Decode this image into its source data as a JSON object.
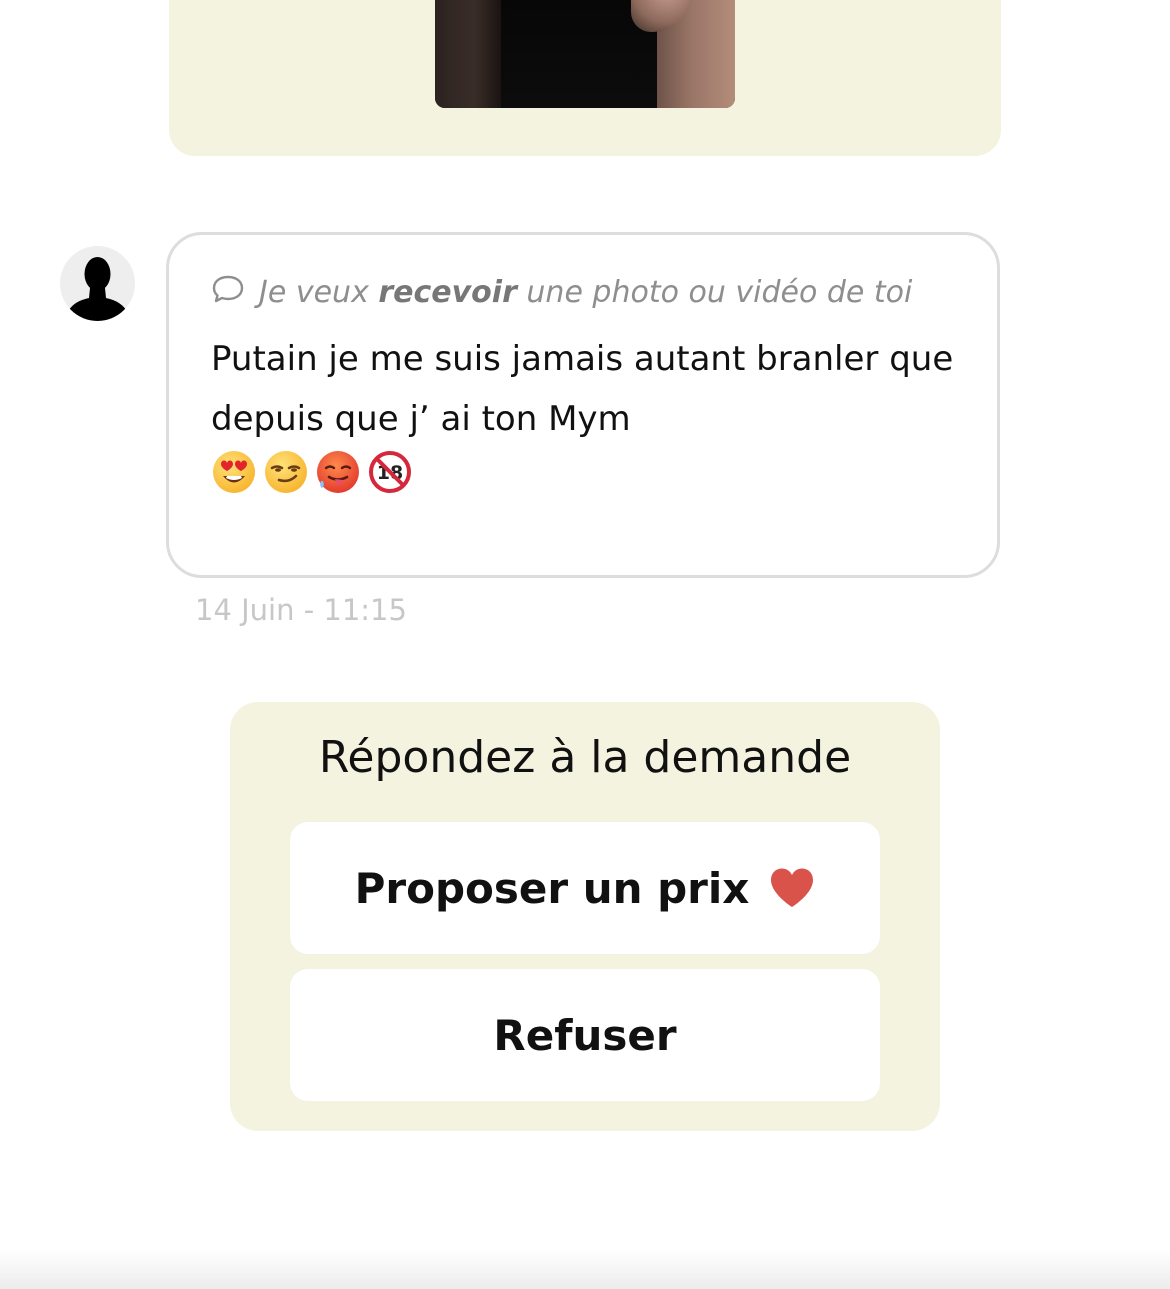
{
  "colors": {
    "card_background": "#f4f3df",
    "bubble_border": "#dddddd",
    "muted_text": "#8e8e8e",
    "timestamp_text": "#c7c7c7",
    "heart": "#d9534a"
  },
  "previous_message": {
    "media": "video-thumbnail"
  },
  "message": {
    "request_icon": "chat-bubble-icon",
    "request_prefix": "Je veux ",
    "request_strong": "recevoir",
    "request_suffix": " une photo ou vidéo de toi",
    "text": "Putain je me suis jamais autant branler que depuis que j’ ai ton Mym",
    "emojis": [
      "heart-eyes-emoji",
      "smirk-emoji",
      "hot-face-emoji",
      "no-under-18-emoji"
    ],
    "timestamp": "14 Juin - 11:15"
  },
  "answer": {
    "title": "Répondez à la demande",
    "propose_label": "Proposer un prix",
    "propose_icon": "heart-icon",
    "refuse_label": "Refuser"
  }
}
